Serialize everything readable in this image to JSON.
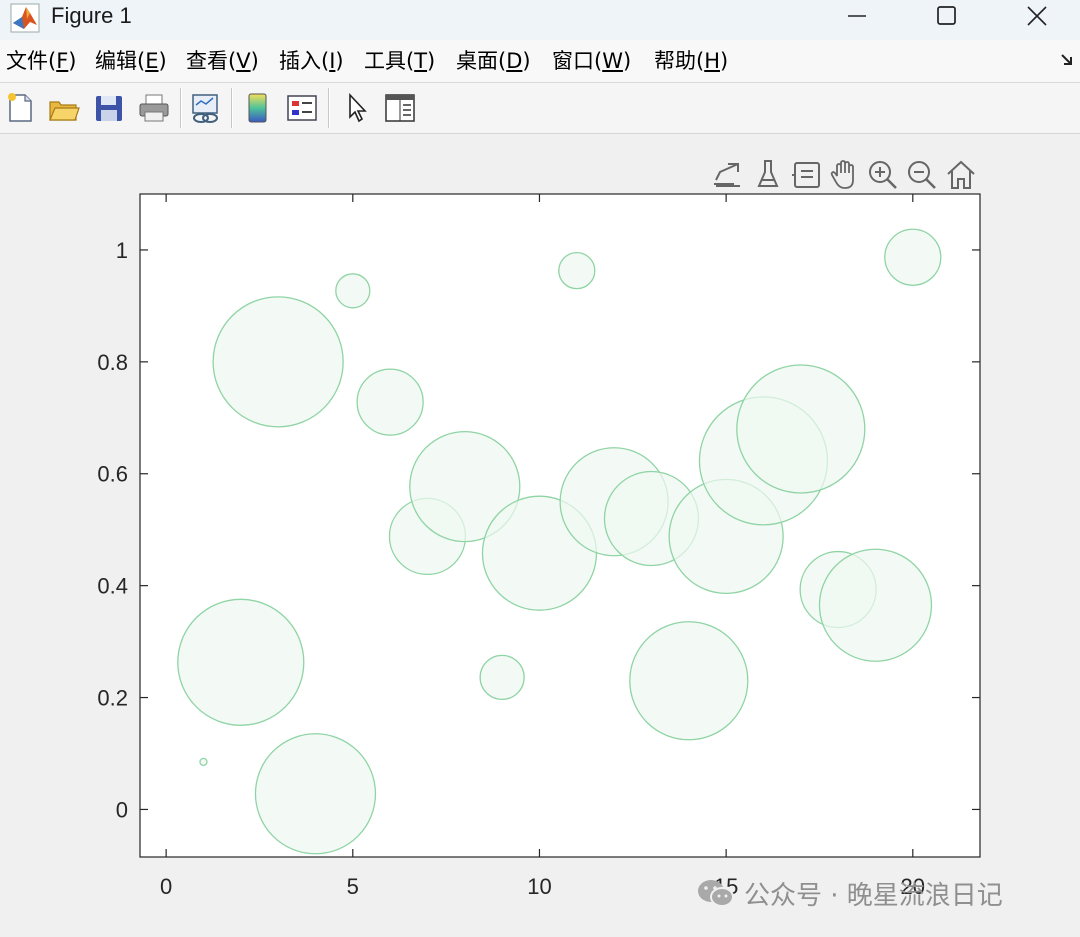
{
  "window": {
    "title": "Figure 1",
    "icon": "matlab-icon"
  },
  "menu": [
    {
      "label": "文件(",
      "mnemonic": "F",
      "end": ")"
    },
    {
      "label": "编辑(",
      "mnemonic": "E",
      "end": ")"
    },
    {
      "label": "查看(",
      "mnemonic": "V",
      "end": ")"
    },
    {
      "label": "插入(",
      "mnemonic": "I",
      "end": ")"
    },
    {
      "label": "工具(",
      "mnemonic": "T",
      "end": ")"
    },
    {
      "label": "桌面(",
      "mnemonic": "D",
      "end": ")"
    },
    {
      "label": "窗口(",
      "mnemonic": "W",
      "end": ")"
    },
    {
      "label": "帮助(",
      "mnemonic": "H",
      "end": ")"
    }
  ],
  "toolbar": [
    "new-figure-icon",
    "open-folder-icon",
    "save-icon",
    "print-icon",
    "link-plot-icon",
    "colorbar-icon",
    "legend-icon",
    "pointer-icon",
    "property-inspector-icon"
  ],
  "axes_toolbar": [
    "export-icon",
    "brush-icon",
    "data-tips-icon",
    "pan-hand-icon",
    "zoom-in-icon",
    "zoom-out-icon",
    "home-icon"
  ],
  "watermark": "公众号 · 晚星流浪日记",
  "chart_data": {
    "type": "scatter",
    "subtype": "bubble",
    "title": "",
    "xlabel": "",
    "ylabel": "",
    "xlim": [
      -0.7,
      21.8
    ],
    "ylim": [
      -0.085,
      1.1
    ],
    "xticks": [
      0,
      5,
      10,
      15,
      20
    ],
    "yticks": [
      0,
      0.2,
      0.4,
      0.6,
      0.8,
      1
    ],
    "ytick_labels": [
      "0",
      "0.2",
      "0.4",
      "0.6",
      "0.8",
      "1"
    ],
    "grid": false,
    "box": true,
    "marker_edge_color": "#8fd4a4",
    "marker_face_color": "#eef8f1",
    "marker_face_alpha": 0.7,
    "points": [
      {
        "x": 1,
        "y": 0.085,
        "size": 1
      },
      {
        "x": 2,
        "y": 0.263,
        "size": 63
      },
      {
        "x": 3,
        "y": 0.8,
        "size": 65
      },
      {
        "x": 4,
        "y": 0.028,
        "size": 60
      },
      {
        "x": 5,
        "y": 0.927,
        "size": 17
      },
      {
        "x": 6,
        "y": 0.728,
        "size": 33
      },
      {
        "x": 7,
        "y": 0.488,
        "size": 38
      },
      {
        "x": 8,
        "y": 0.577,
        "size": 55
      },
      {
        "x": 9,
        "y": 0.236,
        "size": 22
      },
      {
        "x": 10,
        "y": 0.458,
        "size": 57
      },
      {
        "x": 11,
        "y": 0.963,
        "size": 18
      },
      {
        "x": 12,
        "y": 0.55,
        "size": 54
      },
      {
        "x": 13,
        "y": 0.52,
        "size": 47
      },
      {
        "x": 14,
        "y": 0.23,
        "size": 59
      },
      {
        "x": 15,
        "y": 0.488,
        "size": 57
      },
      {
        "x": 16,
        "y": 0.623,
        "size": 64
      },
      {
        "x": 17,
        "y": 0.68,
        "size": 64
      },
      {
        "x": 18,
        "y": 0.393,
        "size": 38
      },
      {
        "x": 19,
        "y": 0.365,
        "size": 56
      },
      {
        "x": 20,
        "y": 0.987,
        "size": 28
      }
    ]
  }
}
